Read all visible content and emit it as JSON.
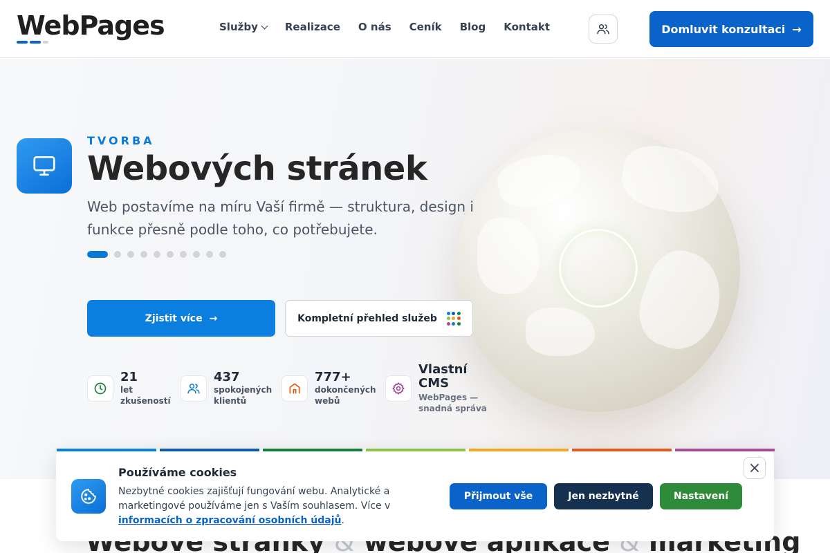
{
  "header": {
    "logo": "WebPages",
    "logo_bar_colors": [
      "#0a63c9",
      "#0a63c9",
      "#cbd5e1"
    ],
    "nav": [
      {
        "label": "Služby",
        "dropdown": true
      },
      {
        "label": "Realizace"
      },
      {
        "label": "O nás"
      },
      {
        "label": "Ceník"
      },
      {
        "label": "Blog"
      },
      {
        "label": "Kontakt"
      }
    ],
    "user_icon": "users-icon",
    "cta_label": "Domluvit konzultaci",
    "cta_arrow": "→"
  },
  "hero": {
    "icon": "monitor-icon",
    "eyebrow": "TVORBA",
    "title": "Webových stránek",
    "lead": "Web postavíme na míru Vaší firmě — struktura, design i funkce přesně podle toho, co potřebujete.",
    "slides_total": 10,
    "slide_active": 1,
    "primary_button": "Zjistit více",
    "primary_arrow": "→",
    "secondary_button": "Kompletní přehled služeb",
    "stats": [
      {
        "icon": "clock-icon",
        "value": "21",
        "label_1": "let",
        "label_2": "zkušeností",
        "color": "#15803d"
      },
      {
        "icon": "users-icon",
        "value": "437",
        "label_1": "spokojených",
        "label_2": "klientů",
        "color": "#0a7ad8"
      },
      {
        "icon": "home-icon",
        "value": "777+",
        "label_1": "dokončených",
        "label_2": "webů",
        "color": "#ea580c"
      },
      {
        "icon": "gear-icon",
        "value": "Vlastní CMS",
        "label_1": "WebPages —",
        "label_2": "snadná správa",
        "color": "#9d3d8f"
      }
    ]
  },
  "section": {
    "headline_part1": "Webové stránky",
    "amp": "&",
    "headline_part2": "webové aplikace",
    "headline_part3": "marketing"
  },
  "strip_colors": [
    "#0b7fe0",
    "#0a5bb0",
    "#15803d",
    "#8bc34a",
    "#f5a623",
    "#e8571e",
    "#a84a9a"
  ],
  "cookies": {
    "icon": "cookie-icon",
    "title": "Používáme cookies",
    "text": "Nezbytné cookies zajišťují fungování webu. Analytické a marketingové používáme jen s Vaším souhlasem. Více v ",
    "link": "informacích o zpracování osobních údajů",
    "text_end": ".",
    "accept_all": "Přijmout vše",
    "necessary_only": "Jen nezbytné",
    "settings": "Nastavení",
    "close_icon": "close-icon"
  }
}
